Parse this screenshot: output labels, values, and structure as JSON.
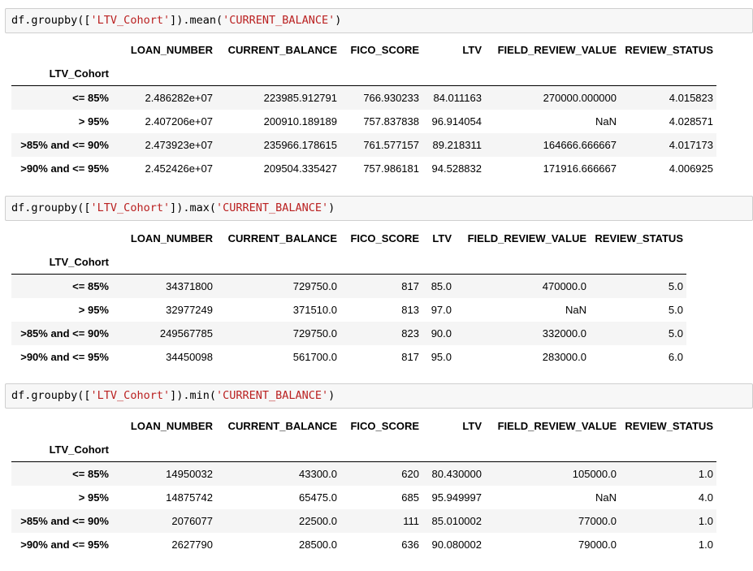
{
  "cells": [
    {
      "code": {
        "prefix": "df.groupby([",
        "arg1": "'LTV_Cohort'",
        "middle": "]).mean(",
        "arg2": "'CURRENT_BALANCE'",
        "suffix": ")"
      },
      "columns": [
        "LOAN_NUMBER",
        "CURRENT_BALANCE",
        "FICO_SCORE",
        "LTV",
        "FIELD_REVIEW_VALUE",
        "REVIEW_STATUS"
      ],
      "index_name": "LTV_Cohort",
      "rows": [
        {
          "index": "<= 85%",
          "values": [
            "2.486282e+07",
            "223985.912791",
            "766.930233",
            "84.011163",
            "270000.000000",
            "4.015823"
          ]
        },
        {
          "index": "> 95%",
          "values": [
            "2.407206e+07",
            "200910.189189",
            "757.837838",
            "96.914054",
            "NaN",
            "4.028571"
          ]
        },
        {
          "index": ">85% and <= 90%",
          "values": [
            "2.473923e+07",
            "235966.178615",
            "761.577157",
            "89.218311",
            "164666.666667",
            "4.017173"
          ]
        },
        {
          "index": ">90% and <= 95%",
          "values": [
            "2.452426e+07",
            "209504.335427",
            "757.986181",
            "94.528832",
            "171916.666667",
            "4.006925"
          ]
        }
      ]
    },
    {
      "code": {
        "prefix": "df.groupby([",
        "arg1": "'LTV_Cohort'",
        "middle": "]).max(",
        "arg2": "'CURRENT_BALANCE'",
        "suffix": ")"
      },
      "columns": [
        "LOAN_NUMBER",
        "CURRENT_BALANCE",
        "FICO_SCORE",
        "LTV",
        "FIELD_REVIEW_VALUE",
        "REVIEW_STATUS"
      ],
      "index_name": "LTV_Cohort",
      "rows": [
        {
          "index": "<= 85%",
          "values": [
            "34371800",
            "729750.0",
            "817",
            "85.0",
            "470000.0",
            "5.0"
          ]
        },
        {
          "index": "> 95%",
          "values": [
            "32977249",
            "371510.0",
            "813",
            "97.0",
            "NaN",
            "5.0"
          ]
        },
        {
          "index": ">85% and <= 90%",
          "values": [
            "249567785",
            "729750.0",
            "823",
            "90.0",
            "332000.0",
            "5.0"
          ]
        },
        {
          "index": ">90% and <= 95%",
          "values": [
            "34450098",
            "561700.0",
            "817",
            "95.0",
            "283000.0",
            "6.0"
          ]
        }
      ]
    },
    {
      "code": {
        "prefix": "df.groupby([",
        "arg1": "'LTV_Cohort'",
        "middle": "]).min(",
        "arg2": "'CURRENT_BALANCE'",
        "suffix": ")"
      },
      "columns": [
        "LOAN_NUMBER",
        "CURRENT_BALANCE",
        "FICO_SCORE",
        "LTV",
        "FIELD_REVIEW_VALUE",
        "REVIEW_STATUS"
      ],
      "index_name": "LTV_Cohort",
      "rows": [
        {
          "index": "<= 85%",
          "values": [
            "14950032",
            "43300.0",
            "620",
            "80.430000",
            "105000.0",
            "1.0"
          ]
        },
        {
          "index": "> 95%",
          "values": [
            "14875742",
            "65475.0",
            "685",
            "95.949997",
            "NaN",
            "4.0"
          ]
        },
        {
          "index": ">85% and <= 90%",
          "values": [
            "2076077",
            "22500.0",
            "111",
            "85.010002",
            "77000.0",
            "1.0"
          ]
        },
        {
          "index": ">90% and <= 95%",
          "values": [
            "2627790",
            "28500.0",
            "636",
            "90.080002",
            "79000.0",
            "1.0"
          ]
        }
      ]
    }
  ]
}
